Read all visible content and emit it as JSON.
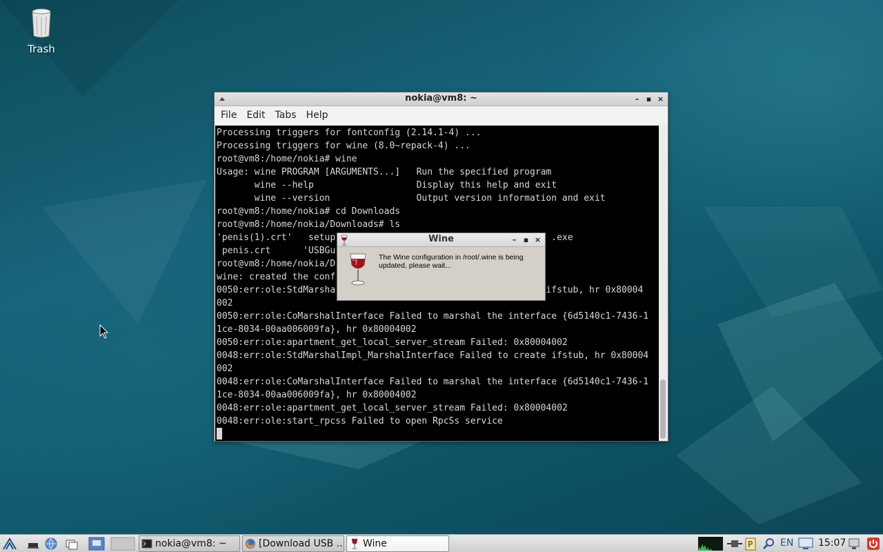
{
  "desktop": {
    "icons": [
      {
        "label": "Trash",
        "icon": "trash-icon"
      }
    ]
  },
  "terminal": {
    "title": "nokia@vm8: ~",
    "menu": [
      "File",
      "Edit",
      "Tabs",
      "Help"
    ],
    "lines": [
      "Processing triggers for fontconfig (2.14.1-4) ...",
      "Processing triggers for wine (8.0~repack-4) ...",
      "root@vm8:/home/nokia# wine",
      "Usage: wine PROGRAM [ARGUMENTS...]   Run the specified program",
      "       wine --help                   Display this help and exit",
      "       wine --version                Output version information and exit",
      "root@vm8:/home/nokia# cd Downloads",
      "root@vm8:/home/nokia/Downloads# ls",
      "'penis(1).crt'   setup                                        .exe",
      " penis.crt      'USBGu",
      "root@vm8:/home/nokia/D",
      "wine: created the conf",
      "0050:err:ole:StdMarsha                                     e ifstub, hr 0x80004",
      "002",
      "0050:err:ole:CoMarshalInterface Failed to marshal the interface {6d5140c1-7436-1",
      "1ce-8034-00aa006009fa}, hr 0x80004002",
      "0050:err:ole:apartment_get_local_server_stream Failed: 0x80004002",
      "0048:err:ole:StdMarshalImpl_MarshalInterface Failed to create ifstub, hr 0x80004",
      "002",
      "0048:err:ole:CoMarshalInterface Failed to marshal the interface {6d5140c1-7436-1",
      "1ce-8034-00aa006009fa}, hr 0x80004002",
      "0048:err:ole:apartment_get_local_server_stream Failed: 0x80004002",
      "0048:err:ole:start_rpcss Failed to open RpcSs service"
    ]
  },
  "wine_dialog": {
    "title": "Wine",
    "message": "The Wine configuration in /root/.wine is being updated, please wait..."
  },
  "taskbar": {
    "tasks": [
      {
        "label": "nokia@vm8: ~",
        "icon": "terminal-icon"
      },
      {
        "label": "[Download USB ...",
        "icon": "firefox-icon"
      },
      {
        "label": "Wine",
        "icon": "wine-icon"
      }
    ],
    "language": "EN",
    "clock": "15:07"
  },
  "colors": {
    "desktop": "#14607a",
    "console_bg": "#000000",
    "console_fg": "#d8d8d8",
    "dialog_bg": "#d4d0c8"
  }
}
